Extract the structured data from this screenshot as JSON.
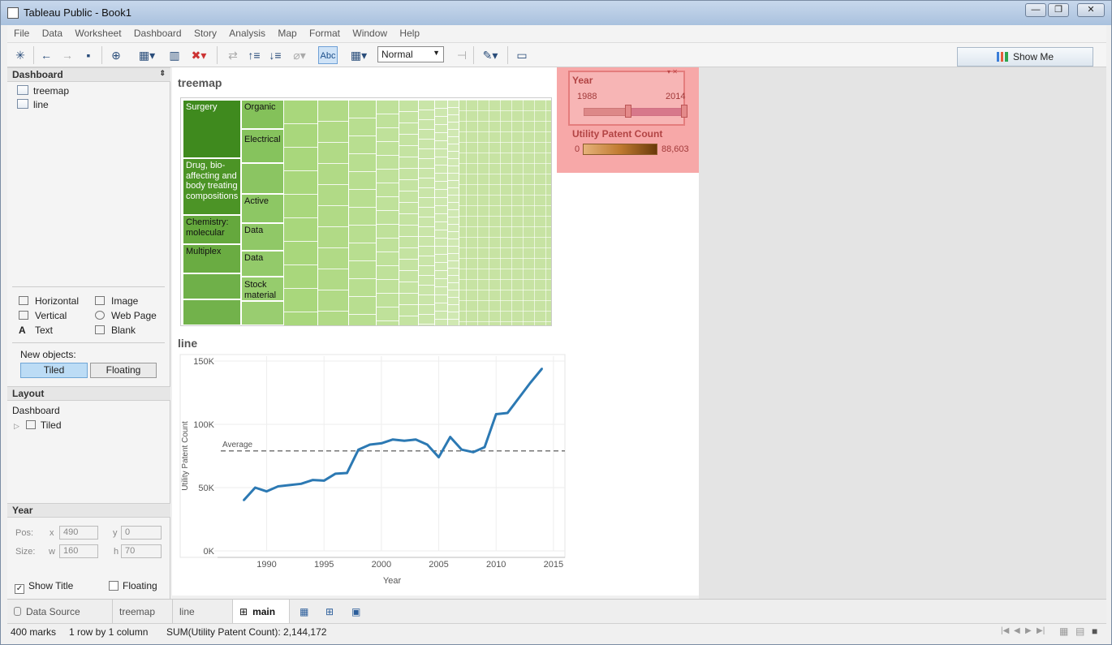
{
  "window": {
    "title": "Tableau Public - Book1"
  },
  "menu": [
    "File",
    "Data",
    "Worksheet",
    "Dashboard",
    "Story",
    "Analysis",
    "Map",
    "Format",
    "Window",
    "Help"
  ],
  "toolbar": {
    "fit_select": "Normal",
    "label_btn": "Abc",
    "show_me": "Show Me"
  },
  "sidebar": {
    "header": "Dashboard",
    "sheets": [
      "treemap",
      "line"
    ],
    "objects": [
      "Horizontal",
      "Vertical",
      "Text",
      "Image",
      "Web Page",
      "Blank"
    ],
    "new_objects_label": "New objects:",
    "tiled": "Tiled",
    "floating": "Floating",
    "layout_header": "Layout",
    "layout_root": "Dashboard",
    "layout_child": "Tiled",
    "year_header": "Year",
    "pos_label": "Pos:",
    "size_label": "Size:",
    "x_label": "x",
    "y_label": "y",
    "w_label": "w",
    "h_label": "h",
    "x": "490",
    "y": "0",
    "w": "160",
    "h": "70",
    "show_title": "Show Title",
    "floating_chk": "Floating"
  },
  "treemap": {
    "title": "treemap",
    "labels": {
      "surgery": "Surgery",
      "organic": "Organic",
      "electrical": "Electrical",
      "drug": "Drug, bio-affecting and body treating compositions",
      "active": "Active",
      "chemistry": "Chemistry: molecular",
      "data1": "Data",
      "multiplex": "Multiplex",
      "data2": "Data",
      "stock": "Stock material"
    }
  },
  "legend": {
    "year_title": "Year",
    "year_min": "1988",
    "year_max": "2014",
    "year_range": [
      1988,
      2014
    ],
    "upc_title": "Utility Patent Count",
    "upc_min": "0",
    "upc_max": "88,603"
  },
  "line_title": "line",
  "chart_data": {
    "type": "line",
    "title": "line",
    "xlabel": "Year",
    "ylabel": "Utility Patent Count",
    "xlim": [
      1986,
      2016
    ],
    "ylim": [
      0,
      150000
    ],
    "x_ticks": [
      "1990",
      "1995",
      "2000",
      "2005",
      "2010",
      "2015"
    ],
    "y_ticks": [
      "0K",
      "50K",
      "100K",
      "150K"
    ],
    "reference_line": {
      "label": "Average",
      "value": 79000
    },
    "series": [
      {
        "x": [
          1988,
          1989,
          1990,
          1991,
          1992,
          1993,
          1994,
          1995,
          1996,
          1997,
          1998,
          1999,
          2000,
          2001,
          2002,
          2003,
          2004,
          2005,
          2006,
          2007,
          2008,
          2009,
          2010,
          2011,
          2012,
          2013,
          2014
        ],
        "values": [
          40000,
          50000,
          47000,
          51000,
          52000,
          53000,
          56000,
          55500,
          61000,
          61500,
          80000,
          84000,
          85000,
          88000,
          87000,
          88000,
          84000,
          74000,
          90000,
          80000,
          78000,
          82000,
          108000,
          109000,
          121000,
          133000,
          144000
        ]
      }
    ],
    "color": "#2c79b3"
  },
  "tabs": [
    "Data Source",
    "treemap",
    "line",
    "main"
  ],
  "status": {
    "marks": "400 marks",
    "rows": "1 row by 1 column",
    "sum": "SUM(Utility Patent Count): 2,144,172"
  }
}
